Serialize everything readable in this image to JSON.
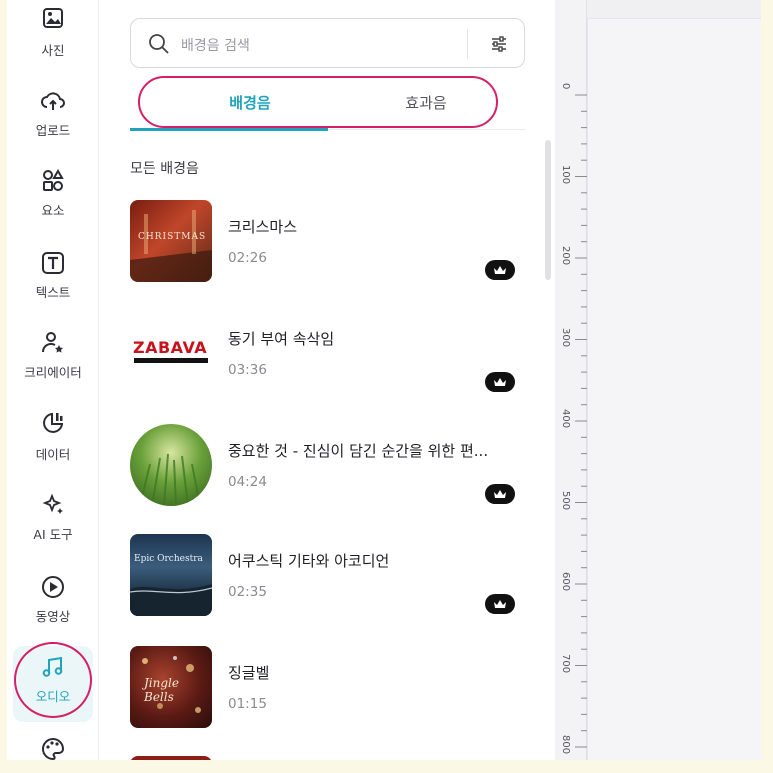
{
  "rail": {
    "items": [
      {
        "label": "사진",
        "icon": "image-icon"
      },
      {
        "label": "업로드",
        "icon": "upload-icon"
      },
      {
        "label": "요소",
        "icon": "shapes-icon"
      },
      {
        "label": "텍스트",
        "icon": "text-icon"
      },
      {
        "label": "크리에이터",
        "icon": "creator-icon"
      },
      {
        "label": "데이터",
        "icon": "chart-icon"
      },
      {
        "label": "AI 도구",
        "icon": "ai-sparkle-icon"
      },
      {
        "label": "동영상",
        "icon": "video-play-icon"
      },
      {
        "label": "오디오",
        "icon": "music-note-icon",
        "active": true
      },
      {
        "label": "",
        "icon": "palette-icon"
      }
    ]
  },
  "search": {
    "placeholder": "배경음 검색"
  },
  "tabs": [
    {
      "label": "배경음",
      "active": true
    },
    {
      "label": "효과음",
      "active": false
    }
  ],
  "section_title": "모든 배경음",
  "tracks": [
    {
      "title": "크리스마스",
      "duration": "02:26",
      "thumb_text": "CHRISTMAS",
      "premium": true
    },
    {
      "title": "동기 부여 속삭임",
      "duration": "03:36",
      "thumb_text": "ZABAVA",
      "premium": true
    },
    {
      "title": "중요한 것 - 진심이 담긴 순간을 위한 편...",
      "duration": "04:24",
      "thumb_text": "",
      "premium": true
    },
    {
      "title": "어쿠스틱 기타와 아코디언",
      "duration": "02:35",
      "thumb_text": "Epic Orchestra",
      "premium": true
    },
    {
      "title": "징글벨",
      "duration": "01:15",
      "thumb_text": "Jingle Bells",
      "premium": false
    }
  ],
  "ruler": {
    "labels": [
      "0",
      "100",
      "200",
      "300",
      "400",
      "500",
      "600",
      "700",
      "800"
    ]
  },
  "colors": {
    "accent": "#22a3bd",
    "highlight": "#d61f69"
  }
}
